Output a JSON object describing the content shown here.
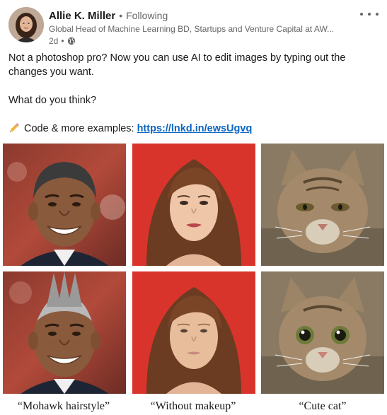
{
  "post": {
    "author_name": "Allie K. Miller",
    "follow_separator": "•",
    "follow_status": "Following",
    "headline": "Global Head of Machine Learning BD, Startups and Venture Capital at AW...",
    "time": "2d",
    "time_separator": "•",
    "visibility_icon": "globe-icon",
    "more_icon": "more-options-icon"
  },
  "body": {
    "line1": "Not a photoshop pro? Now you can use AI to edit images by typing out the changes you want.",
    "line2": "What do you think?",
    "code_prefix": "Code & more examples: ",
    "link_text": "https://lnkd.in/ewsUgvq",
    "pencil_icon": "pencil-icon"
  },
  "images": {
    "row1": [
      "man-original-image",
      "woman-original-image",
      "cat-original-image"
    ],
    "row2": [
      "man-mohawk-image",
      "woman-no-makeup-image",
      "cat-cute-image"
    ]
  },
  "captions": [
    "“Mohawk hairstyle”",
    "“Without makeup”",
    "“Cute cat”"
  ],
  "colors": {
    "link": "#0a66c2",
    "text": "#191919",
    "muted": "#666666",
    "red_backdrop": "#d9342b"
  }
}
